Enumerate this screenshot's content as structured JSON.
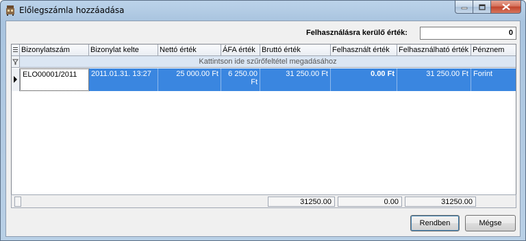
{
  "window": {
    "title": "Előlegszámla hozzáadása"
  },
  "filter": {
    "label": "Felhasználásra kerülő érték:",
    "value": "0"
  },
  "grid": {
    "columns": [
      "Bizonylatszám",
      "Bizonylat kelte",
      "Nettó érték",
      "ÁFA érték",
      "Bruttó érték",
      "Felhasznált érték",
      "Felhasználható érték",
      "Pénznem"
    ],
    "filter_hint": "Kattintson ide szűrőfeltétel megadásához",
    "rows": [
      {
        "doc_no": "ELO00001/2011",
        "date": "2011.01.31. 13:27",
        "net": "25 000.00 Ft",
        "vat": "6 250.00 Ft",
        "gross": "31 250.00 Ft",
        "used": "0.00 Ft",
        "usable": "31 250.00 Ft",
        "currency": "Forint"
      }
    ],
    "totals": {
      "gross": "31250.00",
      "used": "0.00",
      "usable": "31250.00"
    }
  },
  "buttons": {
    "ok": "Rendben",
    "cancel": "Mégse"
  }
}
